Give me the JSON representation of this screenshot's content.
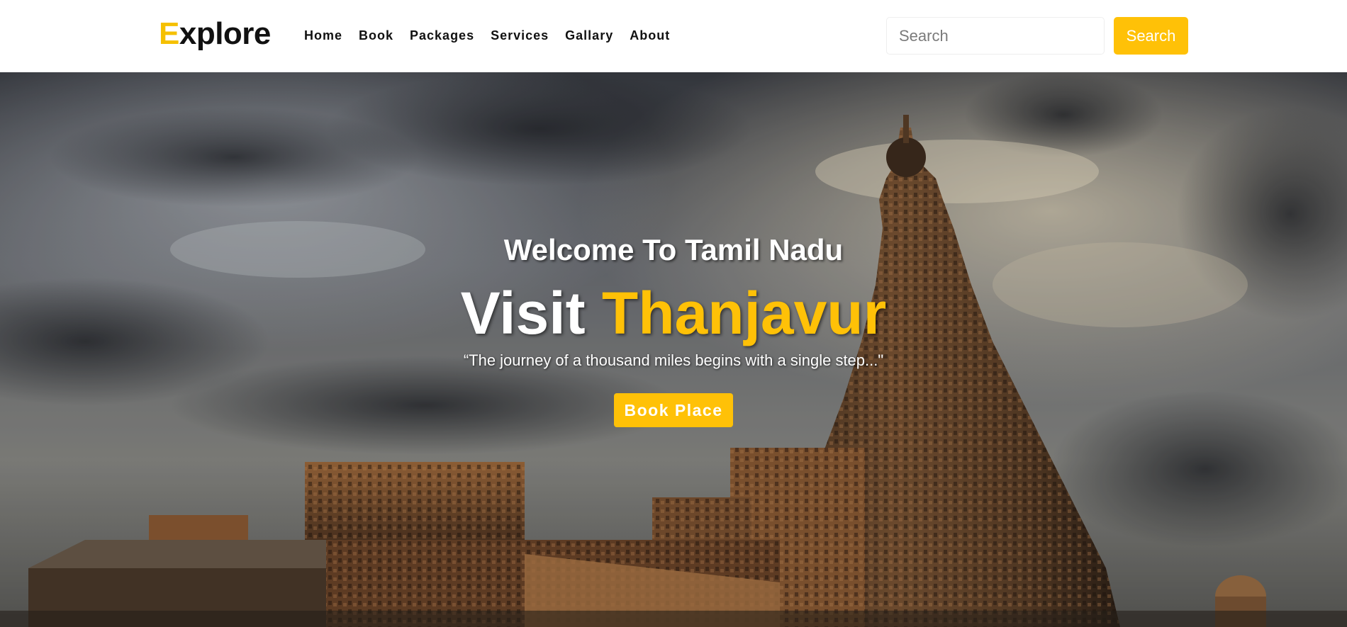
{
  "brand": {
    "first_letter": "E",
    "rest": "xplore"
  },
  "nav": {
    "items": [
      {
        "label": "Home"
      },
      {
        "label": "Book"
      },
      {
        "label": "Packages"
      },
      {
        "label": "Services"
      },
      {
        "label": "Gallary"
      },
      {
        "label": "About"
      }
    ]
  },
  "search": {
    "placeholder": "Search",
    "button_label": "Search"
  },
  "hero": {
    "welcome": "Welcome To Tamil Nadu",
    "visit_prefix": "Visit ",
    "visit_highlight": "Thanjavur",
    "quote": "“The journey of a thousand miles begins with a single step...\"",
    "button_label": "Book Place",
    "background_subject": "temple-under-stormy-sky-photo"
  },
  "colors": {
    "accent": "#ffc107",
    "brand_text": "#111111",
    "hero_text": "#ffffff"
  }
}
